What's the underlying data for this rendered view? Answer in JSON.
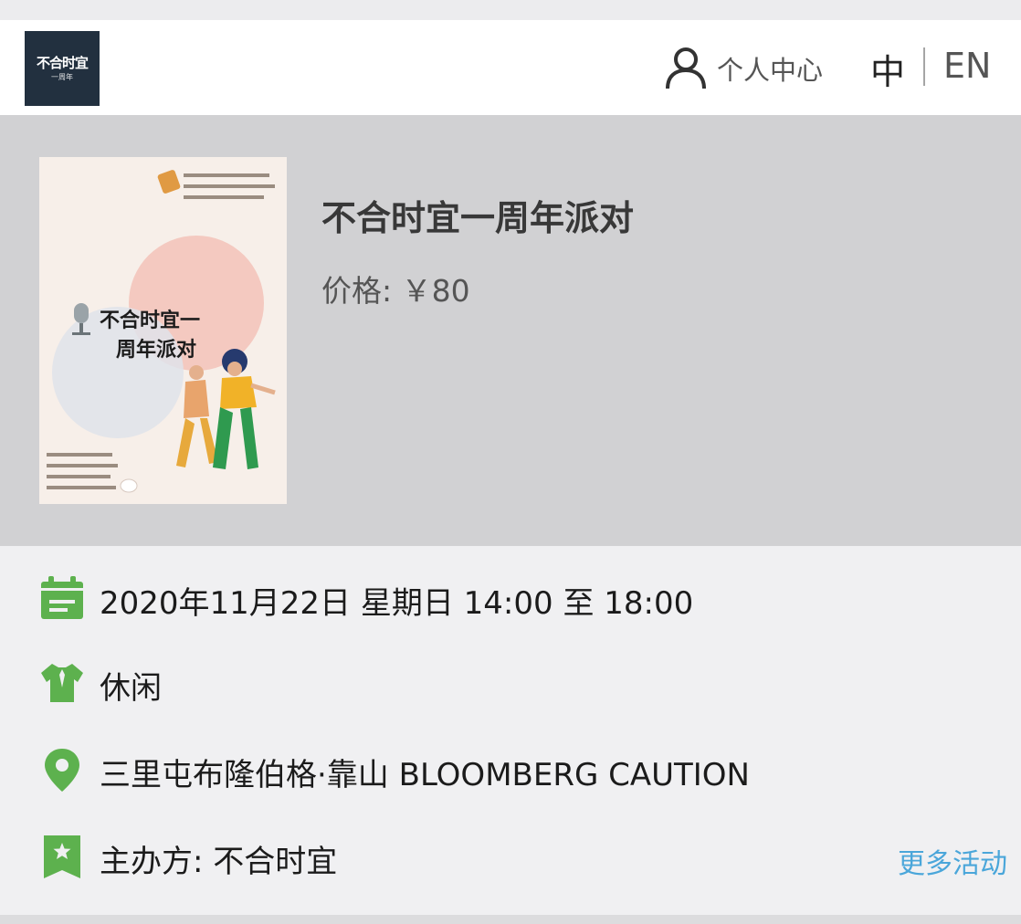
{
  "header": {
    "logo_text": "不合时宜",
    "logo_subtext": "一周年",
    "user_center": "个人中心",
    "lang_zh": "中",
    "lang_en": "EN"
  },
  "event": {
    "title": "不合时宜一周年派对",
    "price_label": "价格:",
    "price_value": "￥80",
    "poster": {
      "title_line1": "不合时宜一",
      "title_line2": "周年派对"
    }
  },
  "details": {
    "datetime": "2020年11月22日 星期日 14:00 至 18:00",
    "category": "休闲",
    "location": "三里屯布隆伯格·靠山 BLOOMBERG CAUTION",
    "organizer_label": "主办方:",
    "organizer_value": "不合时宜",
    "more_events": "更多活动"
  },
  "icons": {
    "user": "user-icon",
    "calendar": "calendar-icon",
    "category": "shirt-icon",
    "location": "map-pin-icon",
    "organizer": "bookmark-star-icon"
  },
  "colors": {
    "accent_green": "#5db14e",
    "link_blue": "#4aa6da",
    "logo_bg": "#22303f",
    "hero_bg": "#d1d1d3"
  }
}
